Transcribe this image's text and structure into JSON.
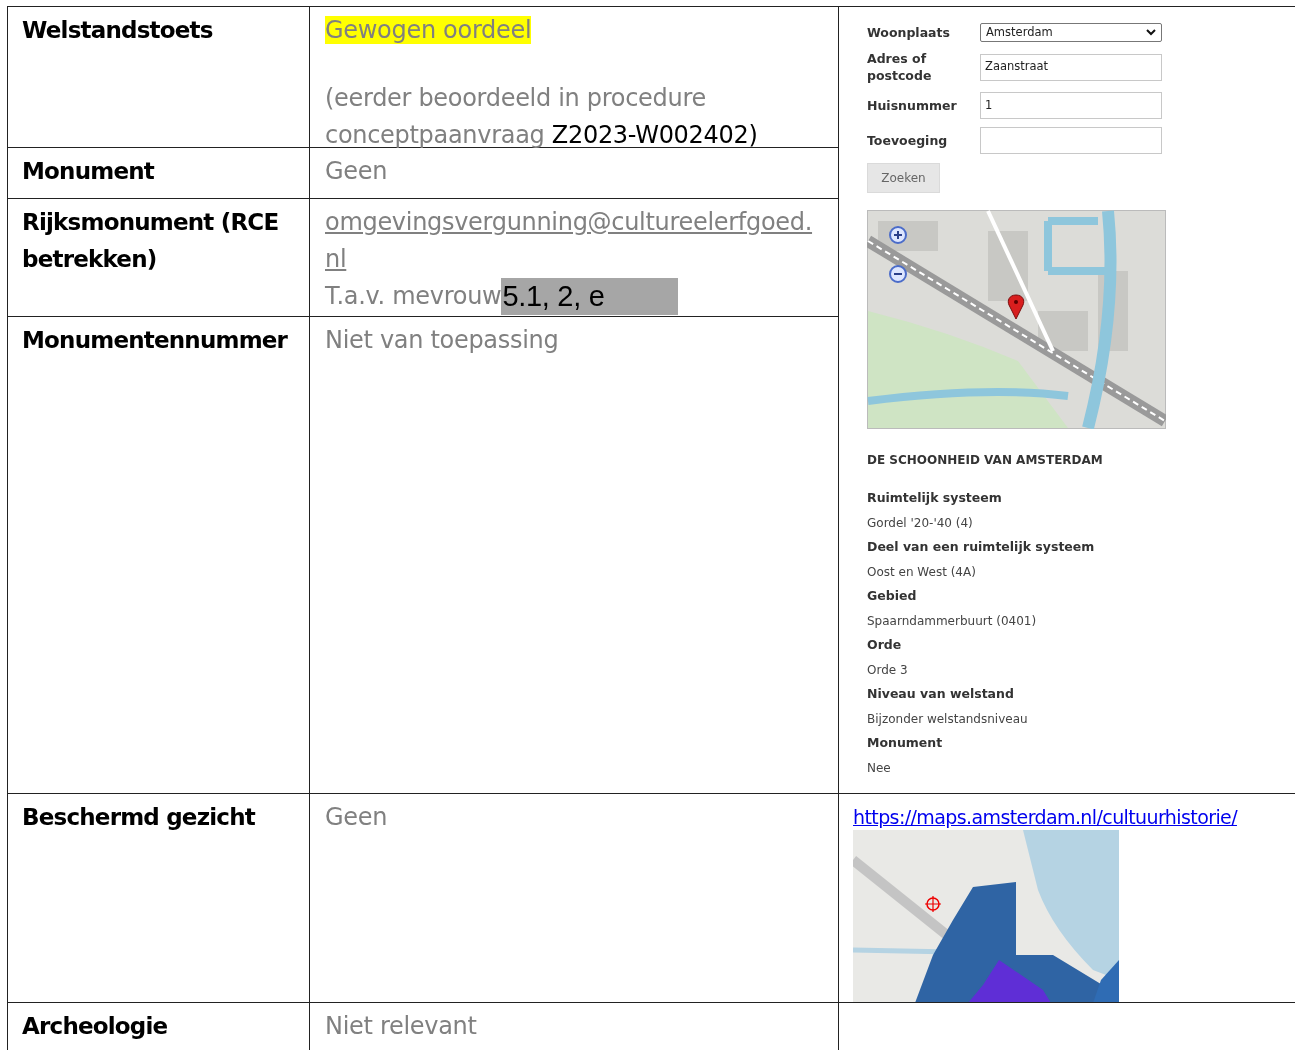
{
  "rows": [
    {
      "label": "Welstandstoets",
      "paragraphs": [
        {
          "spaced": false,
          "parts": [
            {
              "kind": "highlight",
              "text": "Gewogen oordeel"
            }
          ]
        },
        {
          "spaced": true,
          "parts": [
            {
              "kind": "plain",
              "text": "(eerder beoordeeld in procedure conceptpaanvraag "
            },
            {
              "kind": "reference",
              "text": "Z2023-W002402)"
            }
          ]
        }
      ]
    },
    {
      "label": "Monument",
      "paragraphs": [
        {
          "spaced": false,
          "parts": [
            {
              "kind": "plain",
              "text": "Geen"
            }
          ]
        }
      ]
    },
    {
      "label": "Rijksmonument (RCE betrekken)",
      "paragraphs": [
        {
          "spaced": false,
          "parts": [
            {
              "kind": "link",
              "text": "omgevingsvergunning@cultureelerfgoed.nl"
            }
          ]
        },
        {
          "spaced": false,
          "parts": [
            {
              "kind": "plain",
              "text": "T.a.v. mevrouw"
            },
            {
              "kind": "redacted",
              "text": "5.1, 2, e"
            }
          ]
        }
      ]
    },
    {
      "label": "Monumentennummer",
      "paragraphs": [
        {
          "spaced": false,
          "parts": [
            {
              "kind": "plain",
              "text": "Niet van toepassing"
            }
          ]
        }
      ]
    },
    {
      "label": "Beschermd gezicht",
      "paragraphs": [
        {
          "spaced": false,
          "parts": [
            {
              "kind": "plain",
              "text": "Geen"
            }
          ]
        }
      ]
    },
    {
      "label": "Archeologie",
      "paragraphs": [
        {
          "spaced": false,
          "parts": [
            {
              "kind": "plain",
              "text": "Niet relevant"
            }
          ]
        }
      ]
    }
  ],
  "lookup_panel": {
    "fields": [
      {
        "label": "Woonplaats",
        "kind": "select",
        "value": "Amsterdam"
      },
      {
        "label": "Adres of postcode",
        "kind": "text",
        "value": "Zaanstraat"
      },
      {
        "label": "Huisnummer",
        "kind": "text",
        "value": "1"
      },
      {
        "label": "Toevoeging",
        "kind": "text"
      }
    ],
    "button": "Zoeken",
    "heading": "DE SCHOONHEID VAN AMSTERDAM",
    "properties": [
      {
        "label": "Ruimtelijk systeem",
        "value": "Gordel '20-'40 (4)"
      },
      {
        "label": "Deel van een ruimtelijk systeem",
        "value": "Oost en West (4A)"
      },
      {
        "label": "Gebied",
        "value": "Spaarndammerbuurt (0401)"
      },
      {
        "label": "Orde",
        "value": "Orde 3"
      },
      {
        "label": "Niveau van welstand",
        "value": "Bijzonder welstandsniveau"
      },
      {
        "label": "Monument",
        "value": "Nee"
      }
    ]
  },
  "heritage_map": {
    "link": "https://maps.amsterdam.nl/cultuurhistorie/"
  }
}
